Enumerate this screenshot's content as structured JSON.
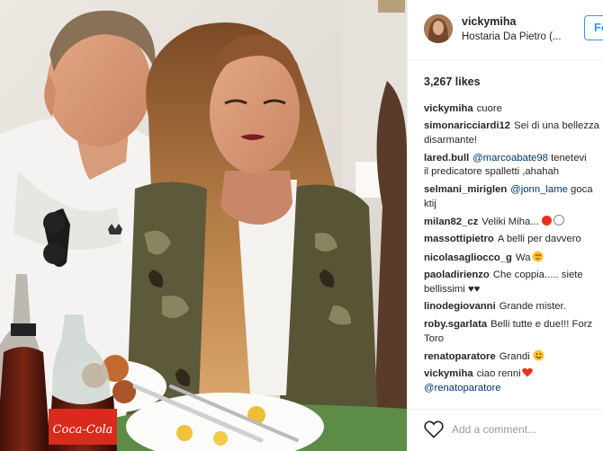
{
  "post": {
    "username": "vickymiha",
    "location": "Hostaria Da Pietro (...",
    "follow_label": "Fo",
    "likes": "3,267 likes",
    "add_comment_placeholder": "Add a comment...",
    "bottle_label": "Coca-Cola"
  },
  "comments": [
    {
      "user": "vickymiha",
      "text": "cuore"
    },
    {
      "user": "simonaricciardi12",
      "text": "Sei di una bellezza",
      "text2": "disarmante!"
    },
    {
      "user": "lared.bull",
      "mention": "@marcoabate98",
      "text": "tenetevi",
      "text2": "il predicatore spalletti ,ahahah"
    },
    {
      "user": "selmani_miriglen",
      "mention": "@jonn_lame",
      "text": "goca",
      "text2": "ktij"
    },
    {
      "user": "milan82_cz",
      "text": "Veliki Miha..."
    },
    {
      "user": "massottipietro",
      "text": "A belli per davvero"
    },
    {
      "user": "nicolasagliocco_g",
      "text": "Wa"
    },
    {
      "user": "paoladirienzo",
      "text": "Che coppia..... siete",
      "text2": "bellissimi ♥♥"
    },
    {
      "user": "linodegiovanni",
      "text": "Grande mister."
    },
    {
      "user": "roby.sgarlata",
      "text": "Belli tutte e due!!! Forz",
      "text2": "Toro"
    },
    {
      "user": "renatoparatore",
      "text": "Grandi"
    },
    {
      "user": "vickymiha",
      "text": "ciao renni",
      "mention2": "@renatoparatore"
    }
  ],
  "colors": {
    "link": "#003569",
    "follow": "#3897f0",
    "border": "#efefef"
  },
  "icons": [
    "heart-icon",
    "red-circle-icon",
    "white-circle-icon",
    "heart-eyes-emoji-icon",
    "smiling-emoji-icon",
    "red-heart-emoji-icon"
  ]
}
